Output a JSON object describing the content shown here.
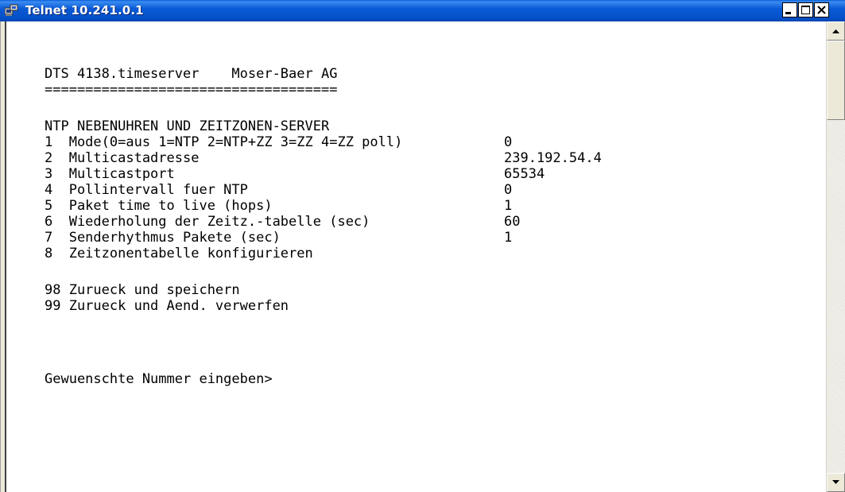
{
  "window": {
    "title": "Telnet 10.241.0.1"
  },
  "icons": {
    "app": "telnet-icon",
    "minimize": "minimize-icon",
    "maximize": "maximize-icon",
    "close": "close-icon",
    "scroll_up": "arrow-up-icon",
    "scroll_down": "arrow-down-icon"
  },
  "colors": {
    "titlebar": "#0b5ad6",
    "terminal_bg": "#ffffff",
    "terminal_text": "#000000"
  },
  "terminal": {
    "header": "DTS 4138.timeserver    Moser-Baer AG",
    "separator": "====================================",
    "section_title": "NTP NEBENUHREN UND ZEITZONEN-SERVER",
    "options": [
      {
        "label": "1  Mode(0=aus 1=NTP 2=NTP+ZZ 3=ZZ 4=ZZ poll)",
        "value": "0"
      },
      {
        "label": "2  Multicastadresse",
        "value": "239.192.54.4"
      },
      {
        "label": "3  Multicastport",
        "value": "65534"
      },
      {
        "label": "4  Pollintervall fuer NTP",
        "value": "0"
      },
      {
        "label": "5  Paket time to live (hops)",
        "value": "1"
      },
      {
        "label": "6  Wiederholung der Zeitz.-tabelle (sec)",
        "value": "60"
      },
      {
        "label": "7  Senderhythmus Pakete (sec)",
        "value": "1"
      },
      {
        "label": "8  Zeitzonentabelle konfigurieren",
        "value": ""
      }
    ],
    "save_option": "98 Zurueck und speichern",
    "discard_option": "99 Zurueck und Aend. verwerfen",
    "prompt": "Gewuenschte Nummer eingeben>"
  }
}
